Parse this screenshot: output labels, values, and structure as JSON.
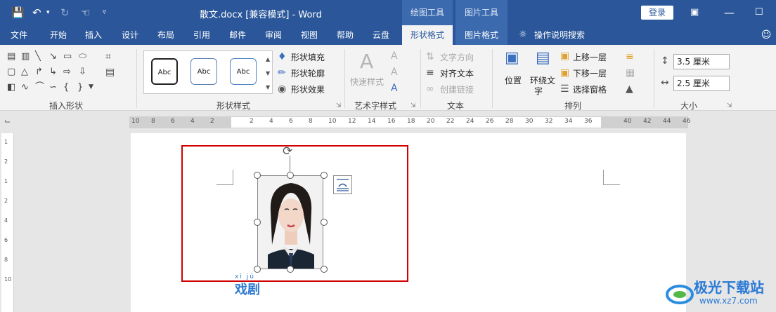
{
  "window": {
    "title": "散文.docx [兼容模式]  -  Word",
    "context_groups": [
      "绘图工具",
      "图片工具"
    ],
    "login_label": "登录"
  },
  "tabs": [
    "文件",
    "开始",
    "插入",
    "设计",
    "布局",
    "引用",
    "邮件",
    "审阅",
    "视图",
    "帮助",
    "云盘",
    "形状格式",
    "图片格式"
  ],
  "active_tab": "形状格式",
  "tell_me": "操作说明搜索",
  "ribbon": {
    "insert_shapes": {
      "label": "插入形状"
    },
    "shape_styles": {
      "label": "形状样式",
      "presets": [
        "Abc",
        "Abc",
        "Abc"
      ],
      "fill": "形状填充",
      "outline": "形状轮廓",
      "effects": "形状效果"
    },
    "wordart": {
      "label": "艺术字样式",
      "quick_styles": "快速样式"
    },
    "text": {
      "label": "文本",
      "direction": "文字方向",
      "align": "对齐文本",
      "link": "创建链接"
    },
    "arrange": {
      "label": "排列",
      "position": "位置",
      "wrap_line1": "环绕文",
      "wrap_line2": "字",
      "bring_forward": "上移一层",
      "send_backward": "下移一层",
      "selection_pane": "选择窗格"
    },
    "size": {
      "label": "大小",
      "height": "3.5 厘米",
      "width": "2.5 厘米"
    }
  },
  "ruler": {
    "ticks": [
      "10",
      "8",
      "6",
      "4",
      "2",
      "",
      "2",
      "4",
      "6",
      "8",
      "10",
      "12",
      "14",
      "16",
      "18",
      "20",
      "22",
      "24",
      "26",
      "28",
      "30",
      "32",
      "34",
      "36",
      "",
      "40",
      "42",
      "44",
      "46"
    ],
    "vticks": [
      "1",
      "2",
      "1",
      "2",
      "4",
      "6",
      "8",
      "10"
    ]
  },
  "document": {
    "pinyin": "xì jù",
    "word": "戏剧"
  },
  "watermark": {
    "title": "极光下载站",
    "url": "www.xz7.com"
  },
  "colors": {
    "accent": "#2b579a",
    "context": "#3c6aaf",
    "highlight": "#d00000",
    "text_blue": "#2f7ad1"
  }
}
